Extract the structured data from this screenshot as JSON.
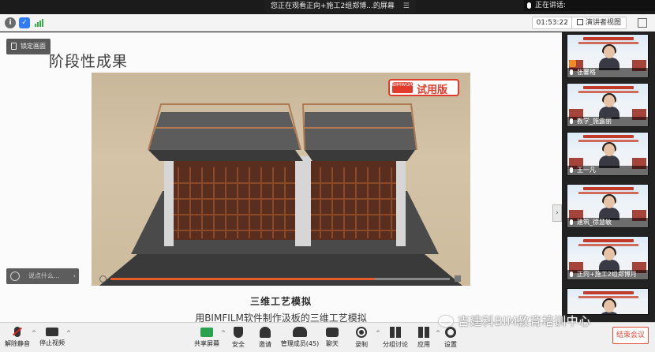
{
  "banner": {
    "text": "您正在观看正向+施工2组郑博...的屏幕",
    "menu_icon": "menu-icon"
  },
  "talking": {
    "label": "正在讲话:"
  },
  "topbar": {
    "timer": "01:53:22",
    "speaker_view": "演讲者视图"
  },
  "stage": {
    "lock_label": "锁定画面",
    "slide_title": "阶段性成果",
    "trial_badge": "试用版",
    "trial_logo": "BIMWORK",
    "caption_title": "三维工艺模拟",
    "caption_line": "用BIMFILM软件制作汲板的三维工艺模拟",
    "video_progress": 0.78,
    "chat_placeholder": "说点什么..."
  },
  "participants": [
    {
      "name": "张馨格",
      "host": true
    },
    {
      "name": "教学_施露丽",
      "host": false
    },
    {
      "name": "王一凡",
      "host": false
    },
    {
      "name": "建筑_徐慧敏",
      "host": false
    },
    {
      "name": "正向+施工2组郑博月",
      "host": false
    },
    {
      "name": "",
      "host": false
    }
  ],
  "toolbar": {
    "unmute": "解除静音",
    "stop_video": "停止视频",
    "share": "共享屏幕",
    "security": "安全",
    "invite": "邀请",
    "participants": "管理成员(45)",
    "chat": "聊天",
    "record": "录制",
    "breakout": "分组讨论",
    "apps": "应用",
    "settings": "设置",
    "end": "结束会议"
  },
  "watermark": "吉建科BIM教育培训中心",
  "colors": {
    "accent": "#e23b2b",
    "share_green": "#2aa14f",
    "end_red": "#e04a3a"
  }
}
